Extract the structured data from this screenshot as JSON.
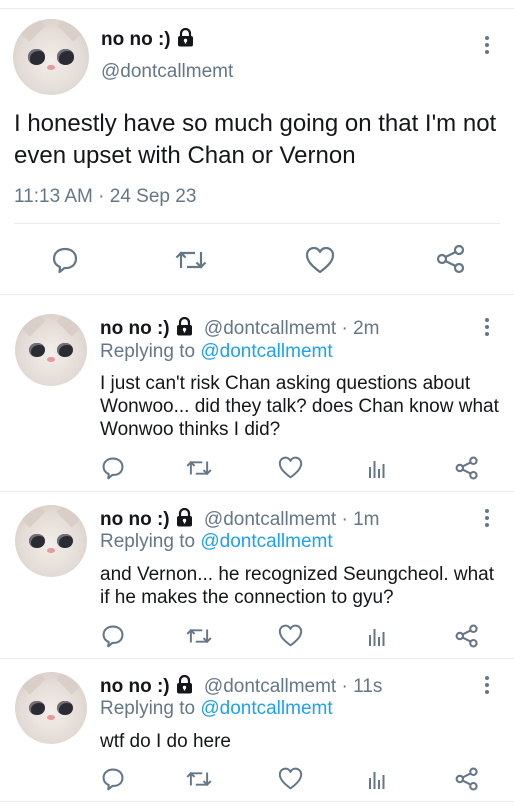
{
  "main_tweet": {
    "display_name": "no no :)",
    "handle": "@dontcallmemt",
    "text": "I honestly have so much going on that I'm not even upset with Chan or Vernon",
    "timestamp": "11:13 AM · 24 Sep 23",
    "icons": [
      "lock-icon",
      "more-icon",
      "reply-icon",
      "retweet-icon",
      "like-icon",
      "share-icon"
    ]
  },
  "replies": [
    {
      "display_name": "no no :)",
      "handle": "@dontcallmemt",
      "age": "· 2m",
      "replying_prefix": "Replying to",
      "replying_to": "@dontcallmemt",
      "text": "I just can't risk Chan asking questions about Wonwoo... did they talk? does Chan know what Wonwoo thinks I did?"
    },
    {
      "display_name": "no no :)",
      "handle": "@dontcallmemt",
      "age": "· 1m",
      "replying_prefix": "Replying to",
      "replying_to": "@dontcallmemt",
      "text": "and Vernon... he recognized Seungcheol. what if he makes the connection to gyu?"
    },
    {
      "display_name": "no no :)",
      "handle": "@dontcallmemt",
      "age": "· 11s",
      "replying_prefix": "Replying to",
      "replying_to": "@dontcallmemt",
      "text": "wtf do I do here"
    }
  ],
  "colors": {
    "text": "#14171a",
    "muted": "#657786",
    "link": "#1da1f2",
    "divider": "#e6ecf0"
  }
}
